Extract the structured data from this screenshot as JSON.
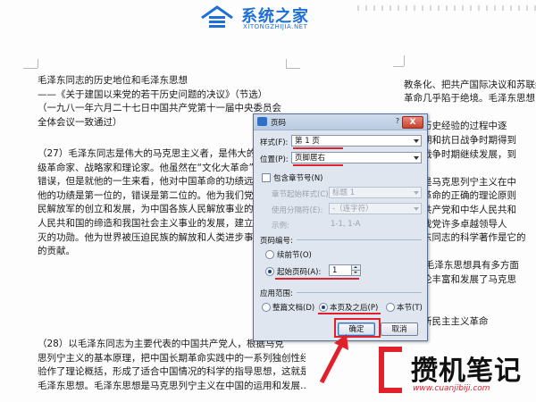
{
  "watermark_top": {
    "title": "系统之家",
    "subtitle": "XITONGZHIJIA.NET"
  },
  "watermark_bottom": {
    "title": "攒机笔记",
    "url": "www.cuanjibiji.com"
  },
  "document": {
    "left_top_lines": [
      "毛泽东同志的历史地位和毛泽东思想",
      "——《关于建国以来党的若干历史问题的决议》（节选）",
      "（一九八一年六月二十七日中国共产党第十一届中央委员会",
      "全体会议一致通过）"
    ],
    "left_mid_lines": [
      "（27）毛泽东同志是伟大的马克思主义者，是伟大的",
      "级革命家、战略家和理论家。他虽然在“文化大革命”中犯",
      "错误，但是就他的一生来看，他对中国革命的功绩远远大于",
      "他的功绩是第一位的，错误是第二位的。他为我们党和中国人",
      "民解放军的创立和发展，为中国各族人民解放事业的胜利，为",
      "人民共和国的缔造和我国社会主义事业的发展，建立了永",
      "灭的功勋。他为世界被压迫民族的解放和人类进步事业作",
      "的贡献。"
    ],
    "left_bottom_lines": [
      "（28）以毛泽东同志为主要代表的中国共产党人，根据马克",
      "思列宁主义的基本原理，把中国长期革命实践中的一系列独创性经",
      "验作了理论概括，形成了适合中国情况的科学的指导思想，这就是",
      "毛泽东思想。毛泽东思想是马克思列宁主义在中国的运用和发展……"
    ],
    "right_lines": [
      "",
      "教条化、把共产国际决议和苏联经验",
      "革命几乎陷于绝境。毛泽东思想",
      "",
      "面的历史经验的过程中逐",
      "争后期和抗日战争时期得到",
      "解放战争时期继续发展，到",
      "",
      "思想是马克思列宁主义在中",
      "中国革命的正确的理论原则",
      "中国共产党和中华人民共和",
      "践。我党许多卓越领导人",
      "毛泽东同志的科学著作是它的",
      "",
      "29）毛泽东思想具有多方面",
      "的理论丰富和发展了马克思",
      "",
      "",
      "关于新民主主义革命",
      ""
    ]
  },
  "dialog": {
    "title": "页码",
    "help": "?",
    "close": "X",
    "style_label": "样式(F):",
    "style_value": "第 1 页",
    "position_label": "位置(P):",
    "position_value": "页脚居右",
    "include_chapter_label": "包含章节号(N)",
    "chapter_style_label": "章节起始样式(C):",
    "chapter_style_value": "标题 1",
    "separator_label": "使用分隔符(E):",
    "separator_value": "-（连字符）",
    "example_label": "示例:",
    "example_value": "1-1, 1-A",
    "numbering_group": "页码编号:",
    "continue_label": "续前节(O)",
    "start_at_label": "起始页码(A):",
    "start_at_value": "1",
    "apply_group": "应用范围:",
    "apply_whole": "整篇文档(D)",
    "apply_this_after": "本页及之后(P)",
    "apply_section": "本节(T)",
    "ok_label": "确定",
    "cancel_label": "取消"
  },
  "colors": {
    "annotation_red": "#e0202a",
    "brand_blue": "#1e6fd6"
  }
}
